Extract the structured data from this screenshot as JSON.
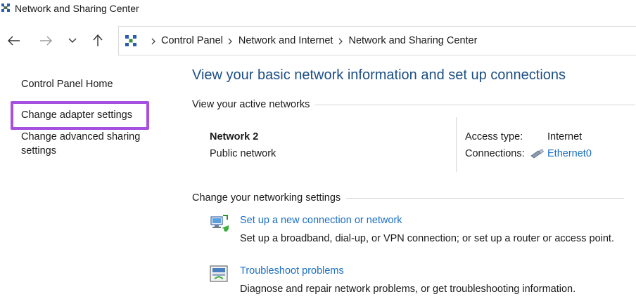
{
  "window": {
    "title": "Network and Sharing Center",
    "app_icon": "network-center-icon"
  },
  "navigation": {
    "back_icon": "arrow-left-icon",
    "forward_icon": "arrow-right-icon",
    "recent_icon": "chevron-down-icon",
    "up_icon": "arrow-up-icon"
  },
  "address_bar": {
    "location_icon": "network-center-icon",
    "breadcrumbs": [
      "Control Panel",
      "Network and Internet",
      "Network and Sharing Center"
    ]
  },
  "sidebar": {
    "items": [
      {
        "label": "Control Panel Home"
      },
      {
        "label": "Change adapter settings"
      },
      {
        "label": "Change advanced sharing settings",
        "line1": "Change advanced sharing",
        "line2": "settings"
      }
    ],
    "highlight_color": "#a550e0"
  },
  "main": {
    "heading": "View your basic network information and set up connections",
    "active_networks": {
      "header": "View your active networks",
      "network_name": "Network 2",
      "network_type": "Public network",
      "access_type_label": "Access type:",
      "access_type_value": "Internet",
      "connections_label": "Connections:",
      "connection_icon": "ethernet-icon",
      "connection_link": "Ethernet0"
    },
    "networking_settings": {
      "header": "Change your networking settings",
      "tasks": [
        {
          "icon": "new-connection-icon",
          "link": "Set up a new connection or network",
          "description": "Set up a broadband, dial-up, or VPN connection; or set up a router or access point."
        },
        {
          "icon": "troubleshoot-icon",
          "link": "Troubleshoot problems",
          "description": "Diagnose and repair network problems, or get troubleshooting information."
        }
      ]
    }
  },
  "colors": {
    "link": "#1a6fc4",
    "heading": "#1c4f85"
  }
}
